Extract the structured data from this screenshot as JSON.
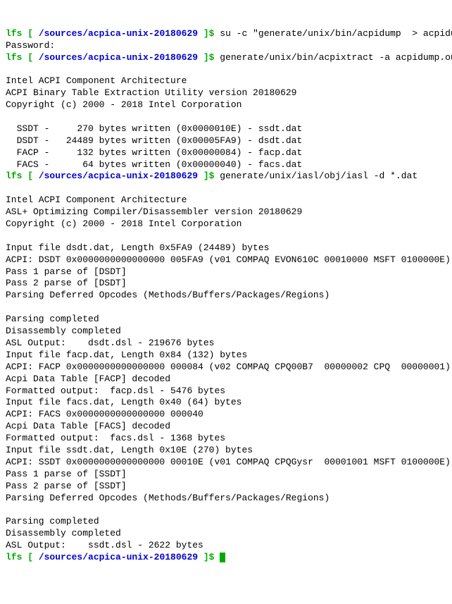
{
  "prompt": {
    "user": "lfs",
    "lb": " [ ",
    "path": "/sources/acpica-unix-20180629",
    "rb": " ]$ "
  },
  "cmd1": "su -c \"generate/unix/bin/acpidump  > acpidump.out\"",
  "password": "Password:",
  "cmd2": "generate/unix/bin/acpixtract -a acpidump.out",
  "blank": "",
  "hdr1": "Intel ACPI Component Architecture",
  "hdr2a": "ACPI Binary Table Extraction Utility version 20180629",
  "copy": "Copyright (c) 2000 - 2018 Intel Corporation",
  "t_ssdt": "  SSDT -     270 bytes written (0x0000010E) - ssdt.dat",
  "t_dsdt": "  DSDT -   24489 bytes written (0x00005FA9) - dsdt.dat",
  "t_facp": "  FACP -     132 bytes written (0x00000084) - facp.dat",
  "t_facs": "  FACS -      64 bytes written (0x00000040) - facs.dat",
  "cmd3": "generate/unix/iasl/obj/iasl -d *.dat",
  "hdr2b": "ASL+ Optimizing Compiler/Disassembler version 20180629",
  "in_dsdt": "Input file dsdt.dat, Length 0x5FA9 (24489) bytes",
  "acpi_dsdt": "ACPI: DSDT 0x0000000000000000 005FA9 (v01 COMPAQ EVON610C 00010000 MSFT 0100000E)",
  "p1_dsdt": "Pass 1 parse of [DSDT]",
  "p2_dsdt": "Pass 2 parse of [DSDT]",
  "defer": "Parsing Deferred Opcodes (Methods/Buffers/Packages/Regions)",
  "pcomp": "Parsing completed",
  "dcomp": "Disassembly completed",
  "out_dsdt": "ASL Output:    dsdt.dsl - 219676 bytes",
  "in_facp": "Input file facp.dat, Length 0x84 (132) bytes",
  "acpi_facp": "ACPI: FACP 0x0000000000000000 000084 (v02 COMPAQ CPQ00B7  00000002 CPQ  00000001)",
  "dec_facp": "Acpi Data Table [FACP] decoded",
  "out_facp": "Formatted output:  facp.dsl - 5476 bytes",
  "in_facs": "Input file facs.dat, Length 0x40 (64) bytes",
  "acpi_facs": "ACPI: FACS 0x0000000000000000 000040",
  "dec_facs": "Acpi Data Table [FACS] decoded",
  "out_facs": "Formatted output:  facs.dsl - 1368 bytes",
  "in_ssdt": "Input file ssdt.dat, Length 0x10E (270) bytes",
  "acpi_ssdt": "ACPI: SSDT 0x0000000000000000 00010E (v01 COMPAQ CPQGysr  00001001 MSFT 0100000E)",
  "p1_ssdt": "Pass 1 parse of [SSDT]",
  "p2_ssdt": "Pass 2 parse of [SSDT]",
  "out_ssdt": "ASL Output:    ssdt.dsl - 2622 bytes"
}
